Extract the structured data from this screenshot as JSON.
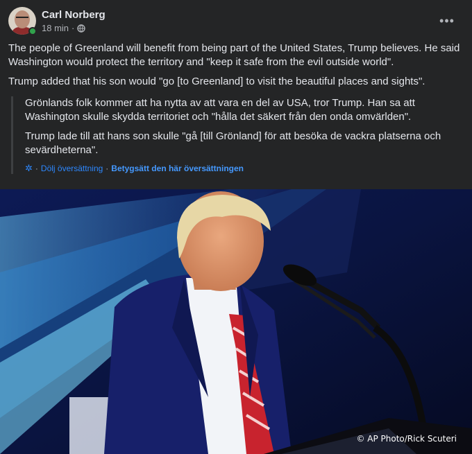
{
  "post": {
    "author": "Carl Norberg",
    "time": "18 min",
    "separator": "·",
    "more_label": "•••",
    "paragraphs": [
      "The people of Greenland will benefit from being part of the United States, Trump believes. He said Washington would protect the territory and \"keep it safe from the evil outside world\".",
      "Trump added that his son would \"go [to Greenland] to visit the beautiful places and sights\"."
    ],
    "translation": {
      "paragraphs": [
        "Grönlands folk kommer att ha nytta av att vara en del av USA, tror Trump. Han sa att Washington skulle skydda territoriet och \"hålla det säkert från den onda omvärlden\".",
        "Trump lade till att hans son skulle \"gå [till Grönland] för att besöka de vackra platserna och sevärdheterna\"."
      ],
      "hide_label": "Dölj översättning",
      "rate_label": "Betygsätt den här översättningen",
      "dot": "·"
    },
    "photo_credit": "© AP Photo/Rick Scuteri"
  },
  "colors": {
    "background": "#242526",
    "text_primary": "#e4e6eb",
    "text_secondary": "#b0b3b8",
    "link": "#2d88ff",
    "online": "#31a24c"
  },
  "icons": {
    "privacy": "globe-icon",
    "menu": "more-icon",
    "translate": "gear-icon"
  }
}
